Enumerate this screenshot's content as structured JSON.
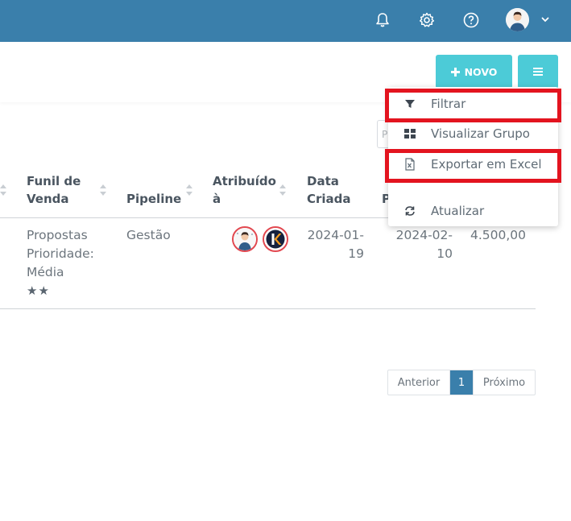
{
  "topbar": {
    "icons": [
      "bell-icon",
      "gear-icon",
      "help-circle-icon",
      "user-avatar",
      "chevron-down-icon"
    ],
    "color": "#3a7fab"
  },
  "toolbar": {
    "new_label": "NOVO",
    "new_icon": "plus-icon",
    "menu_icon": "hamburger-icon",
    "accent": "#4ccbd7"
  },
  "search": {
    "placeholder": "P"
  },
  "table": {
    "headers": {
      "funil_line1": "Funil de",
      "funil_line2": "Venda",
      "pipeline": "Pipeline",
      "atribuido_line1": "Atribuído",
      "atribuido_line2": "à",
      "data_line1": "Data",
      "data_line2": "Criada",
      "next_partial": "P"
    },
    "rows": [
      {
        "funil_line1": "Propostas",
        "funil_line2": "Prioridade:",
        "funil_line3": "Média",
        "stars": "★★",
        "pipeline": "Gestão",
        "assignees": [
          "user-avatar",
          "k-logo-avatar"
        ],
        "data_criada_line1": "2024-01-",
        "data_criada_line2": "19",
        "data_prevista_line1": "2024-02-",
        "data_prevista_line2": "10",
        "valor": "4.500,00"
      }
    ]
  },
  "pagination": {
    "prev": "Anterior",
    "current": "1",
    "next": "Próximo",
    "active_color": "#3a7fab"
  },
  "dropdown": {
    "items": [
      {
        "label": "Filtrar",
        "icon": "filter-icon"
      },
      {
        "label": "Visualizar Grupo",
        "icon": "grid-icon"
      },
      {
        "label": "Exportar em Excel",
        "icon": "excel-file-icon"
      },
      {
        "label": "Atualizar",
        "icon": "refresh-icon"
      }
    ]
  },
  "highlight_color": "#e3141f"
}
